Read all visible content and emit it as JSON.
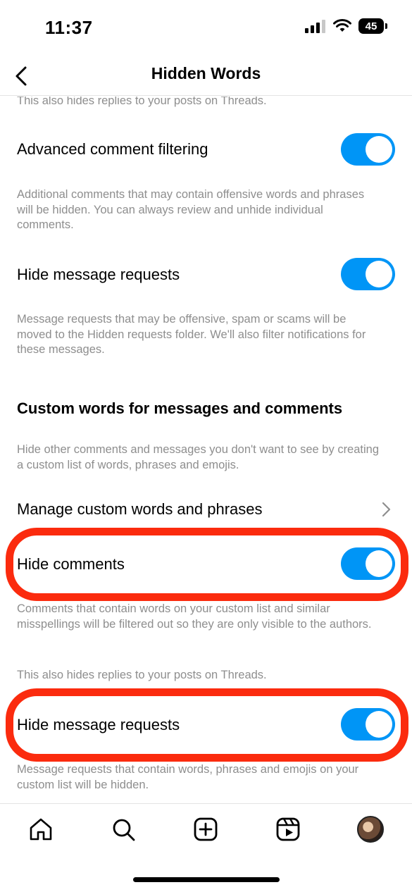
{
  "status_bar": {
    "time": "11:37",
    "battery": "45"
  },
  "header": {
    "title": "Hidden Words"
  },
  "sections": {
    "top_note": "This also hides replies to your posts on Threads.",
    "advanced_filtering": {
      "label": "Advanced comment filtering",
      "enabled": true,
      "description": "Additional comments that may contain offensive words and phrases will be hidden. You can always review and unhide individual comments."
    },
    "hide_message_requests_1": {
      "label": "Hide message requests",
      "enabled": true,
      "description": "Message requests that may be offensive, spam or scams will be moved to the Hidden requests folder. We'll also filter notifications for these messages."
    },
    "custom_words": {
      "heading": "Custom words for messages and comments",
      "description": "Hide other comments and messages you don't want to see by creating a custom list of words, phrases and emojis.",
      "manage_label": "Manage custom words and phrases"
    },
    "hide_comments": {
      "label": "Hide comments",
      "enabled": true,
      "description": "Comments that contain words on your custom list and similar misspellings will be filtered out so they are only visible to the authors.",
      "note": "This also hides replies to your posts on Threads."
    },
    "hide_message_requests_2": {
      "label": "Hide message requests",
      "enabled": true,
      "description": "Message requests that contain words, phrases and emojis on your custom list will be hidden."
    }
  },
  "tab_bar": {
    "items": [
      "home-icon",
      "search-icon",
      "create-icon",
      "reels-icon",
      "profile-avatar"
    ]
  },
  "colors": {
    "toggle_on": "#0095f6",
    "highlight": "#fb2b0e",
    "secondary_text": "#8e8e8e"
  }
}
